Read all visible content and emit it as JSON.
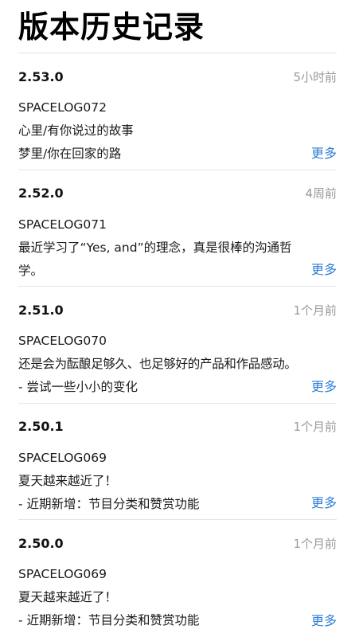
{
  "page": {
    "title": "版本历史记录"
  },
  "colors": {
    "link": "#2f7fd6",
    "time": "#9a9a9a",
    "divider": "#e5e5e5"
  },
  "entries": [
    {
      "version": "2.53.0",
      "time": "5小时前",
      "lines": [
        "SPACELOG072",
        "心里/有你说过的故事",
        "梦里/你在回家的路"
      ],
      "more": "更多"
    },
    {
      "version": "2.52.0",
      "time": "4周前",
      "lines": [
        "SPACELOG071",
        "最近学习了“Yes, and”的理念，真是很棒的沟通哲学。"
      ],
      "more": "更多"
    },
    {
      "version": "2.51.0",
      "time": "1个月前",
      "lines": [
        "SPACELOG070",
        "还是会为酝酿足够久、也足够好的产品和作品感动。",
        "- 尝试一些小小的变化"
      ],
      "more": "更多"
    },
    {
      "version": "2.50.1",
      "time": "1个月前",
      "lines": [
        "SPACELOG069",
        "夏天越来越近了！",
        "- 近期新增：节目分类和赞赏功能"
      ],
      "more": "更多"
    },
    {
      "version": "2.50.0",
      "time": "1个月前",
      "lines": [
        "SPACELOG069",
        "夏天越来越近了！",
        "- 近期新增：节目分类和赞赏功能"
      ],
      "more": "更多"
    }
  ]
}
